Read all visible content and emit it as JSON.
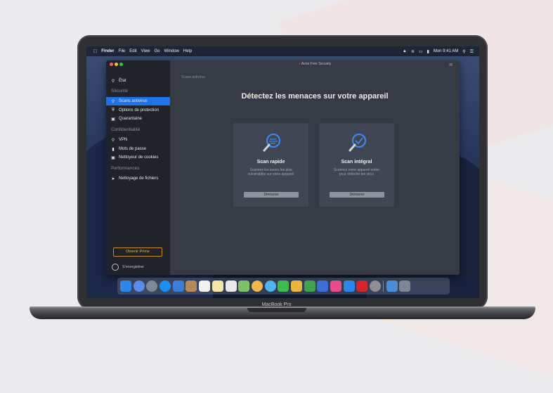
{
  "menubar": {
    "items": [
      "Finder",
      "File",
      "Edit",
      "View",
      "Go",
      "Window",
      "Help"
    ],
    "clock": "Mon 9:41 AM"
  },
  "window": {
    "title": "Avira Free Security"
  },
  "sidebar": {
    "status_label": "État",
    "sections": {
      "security": "Sécurité",
      "privacy": "Confidentialité",
      "performance": "Performances"
    },
    "items": {
      "scans": "Scans antivirus",
      "protection": "Options de protection",
      "quarantine": "Quarantaine",
      "vpn": "VPN",
      "passwords": "Mots de passe",
      "cookies": "Nettoyeur de cookies",
      "files": "Nettoyage de fichiers"
    },
    "prime_button": "Obtenir Prime",
    "login_label": "S'enregistrer"
  },
  "main": {
    "breadcrumb": "Scans antivirus",
    "headline": "Détectez les menaces sur votre appareil",
    "cards": [
      {
        "title": "Scan rapide",
        "description": "Scannez les zones les plus vulnérables sur votre appareil",
        "button": "Démarrer"
      },
      {
        "title": "Scan intégral",
        "description": "Scannez votre appareil entier pour détecter les virus",
        "button": "Démarrer"
      }
    ]
  },
  "laptop": {
    "brand": "MacBook Pro"
  },
  "colors": {
    "accent": "#1e73e8",
    "prime": "#c98f1d",
    "sidebar_bg": "#202329",
    "main_bg": "#353a45",
    "card_bg": "#404654"
  }
}
